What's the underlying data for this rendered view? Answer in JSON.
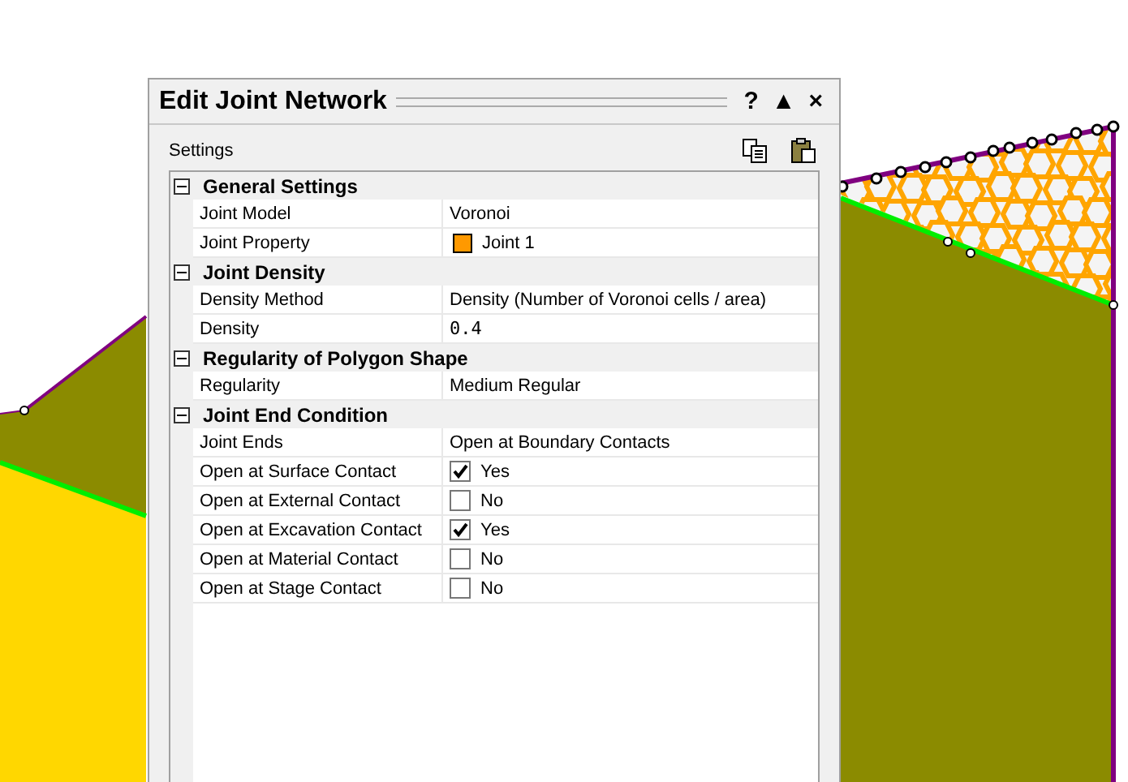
{
  "dialog": {
    "title": "Edit Joint Network",
    "controls": [
      "?",
      "▲",
      "×"
    ],
    "settings_label": "Settings"
  },
  "sections": [
    {
      "title": "General Settings",
      "expanded": true,
      "rows": [
        {
          "kind": "text",
          "name": "Joint Model",
          "value": "Voronoi"
        },
        {
          "kind": "color",
          "name": "Joint Property",
          "value": "Joint 1",
          "color": "#ff9900"
        }
      ]
    },
    {
      "title": "Joint Density",
      "expanded": true,
      "rows": [
        {
          "kind": "text",
          "name": "Density Method",
          "value": "Density (Number of Voronoi cells /  area)"
        },
        {
          "kind": "text",
          "name": "Density",
          "value": "0.4"
        }
      ]
    },
    {
      "title": "Regularity of Polygon Shape",
      "expanded": true,
      "rows": [
        {
          "kind": "text",
          "name": "Regularity",
          "value": "Medium Regular"
        }
      ]
    },
    {
      "title": "Joint End Condition",
      "expanded": true,
      "rows": [
        {
          "kind": "text",
          "name": "Joint Ends",
          "value": "Open at Boundary Contacts"
        },
        {
          "kind": "check",
          "name": "Open at Surface Contact",
          "value": "Yes",
          "checked": true
        },
        {
          "kind": "check",
          "name": "Open at External Contact",
          "value": "No",
          "checked": false
        },
        {
          "kind": "check",
          "name": "Open at Excavation Contact",
          "value": "Yes",
          "checked": true
        },
        {
          "kind": "check",
          "name": "Open at Material Contact",
          "value": "No",
          "checked": false
        },
        {
          "kind": "check",
          "name": "Open at Stage Contact",
          "value": "No",
          "checked": false
        }
      ]
    }
  ]
}
